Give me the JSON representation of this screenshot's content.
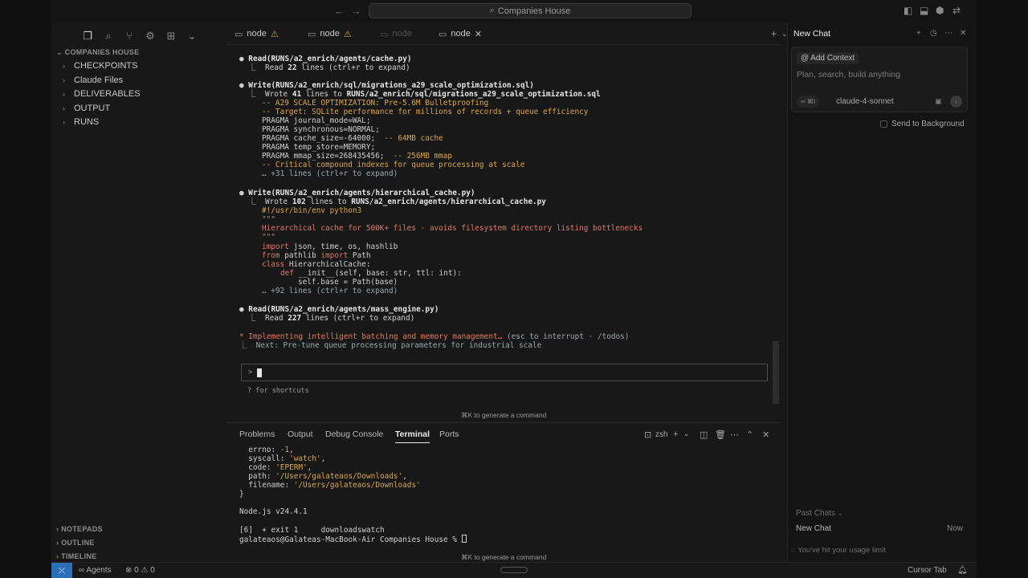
{
  "titlebar": {
    "search": "Companies House",
    "back_icon": "arrow-left-icon",
    "forward_icon": "arrow-right-icon"
  },
  "sidebar": {
    "explorer_title": "COMPANIES HOUSE",
    "items": [
      {
        "label": "CHECKPOINTS"
      },
      {
        "label": "Claude Files"
      },
      {
        "label": "DELIVERABLES"
      },
      {
        "label": "OUTPUT"
      },
      {
        "label": "RUNS"
      }
    ],
    "bottom_sections": [
      "NOTEPADS",
      "OUTLINE",
      "TIMELINE"
    ]
  },
  "tabs": [
    {
      "label": "node",
      "warning": true
    },
    {
      "label": "node",
      "warning": true
    },
    {
      "label": "node",
      "warning": false,
      "dim": true
    },
    {
      "label": "node",
      "warning": false,
      "active": true
    }
  ],
  "editor": {
    "lines": {
      "l1": "Read(RUNS/a2_enrich/agents/cache.py)",
      "l2": "⎿  Read ",
      "l2b": "22",
      "l2c": " lines (ctrl+r to expand)",
      "l3": "Write(RUNS/a2_enrich/sql/migrations_a29_scale_optimization.sql)",
      "l4a": "⎿  Wrote ",
      "l4b": "41",
      "l4c": " lines to ",
      "l4d": "RUNS/a2_enrich/sql/migrations_a29_scale_optimization.sql",
      "l5": "-- A29 SCALE OPTIMIZATION: Pre-5.6M Bulletproofing",
      "l6": "-- Target: SQLite performance for millions of records + queue efficiency",
      "l7": "PRAGMA journal_mode=WAL;",
      "l8": "PRAGMA synchronous=NORMAL;",
      "l9a": "PRAGMA cache_size=-64000;",
      "l9b": "  -- 64MB cache",
      "l10": "PRAGMA temp_store=MEMORY;",
      "l11a": "PRAGMA mmap_size=268435456;",
      "l11b": "  -- 256MB mmap",
      "l12": "-- Critical compound indexes for queue processing at scale",
      "l13": "… +31 lines (ctrl+r to expand)",
      "l14": "Write(RUNS/a2_enrich/agents/hierarchical_cache.py)",
      "l15a": "⎿  Wrote ",
      "l15b": "102",
      "l15c": " lines to ",
      "l15d": "RUNS/a2_enrich/agents/hierarchical_cache.py",
      "l16": "#!/usr/bin/env python3",
      "l17": "\"\"\"",
      "l18": "Hierarchical cache for 500K+ files - avoids filesystem directory listing bottlenecks",
      "l19": "\"\"\"",
      "l20a": "import",
      "l20b": " json, time, os, hashlib",
      "l21a": "from",
      "l21b": " pathlib ",
      "l21c": "import",
      "l21d": " Path",
      "l22a": "class",
      "l22b": " HierarchicalCache:",
      "l23a": "def",
      "l23b": " __init__(self, base: str, ttl: int):",
      "l24": "self.base = Path(base)",
      "l25": "… +92 lines (ctrl+r to expand)",
      "l26": "Read(RUNS/a2_enrich/agents/mass_engine.py)",
      "l27a": "⎿  Read ",
      "l27b": "227",
      "l27c": " lines (ctrl+r to expand)",
      "l28a": "* Implementing intelligent batching and memory management…",
      "l28b": " (esc to interrupt · /todos)",
      "l29": "⎿  Next: Pre-tune queue processing parameters for industrial scale"
    },
    "prompt_symbol": ">",
    "shortcuts_hint": "? for shortcuts",
    "generate_hint": "⌘K to generate a command"
  },
  "panel": {
    "tabs": [
      "Problems",
      "Output",
      "Debug Console",
      "Terminal",
      "Ports"
    ],
    "active_tab": "Terminal",
    "shell": "zsh",
    "lines": {
      "t1a": "  errno: ",
      "t1b": "-1",
      "t1c": ",",
      "t2a": "  syscall: ",
      "t2b": "'watch'",
      "t2c": ",",
      "t3a": "  code: ",
      "t3b": "'EPERM'",
      "t3c": ",",
      "t4a": "  path: ",
      "t4b": "'/Users/galateaos/Downloads'",
      "t4c": ",",
      "t5a": "  filename: ",
      "t5b": "'/Users/galateaos/Downloads'",
      "t6": "}",
      "t7": "Node.js v24.4.1",
      "t8": "[6]  + exit 1     downloadswatch",
      "t9": "galateaos@Galateas-MacBook-Air Companies House % "
    },
    "generate_hint": "⌘K to generate a command"
  },
  "chat": {
    "title": "New Chat",
    "add_context": "Add Context",
    "placeholder": "Plan, search, build anything",
    "mode": "∞ ⌘I",
    "model": "claude-4-sonnet",
    "send_background": "Send to Background",
    "past_chats": "Past Chats",
    "past_item": "New Chat",
    "past_time": "Now",
    "usage_limit": "You've hit your usage limit"
  },
  "status": {
    "agents": "Agents",
    "errors": "0",
    "warnings": "0",
    "cursor_tab": "Cursor Tab"
  }
}
